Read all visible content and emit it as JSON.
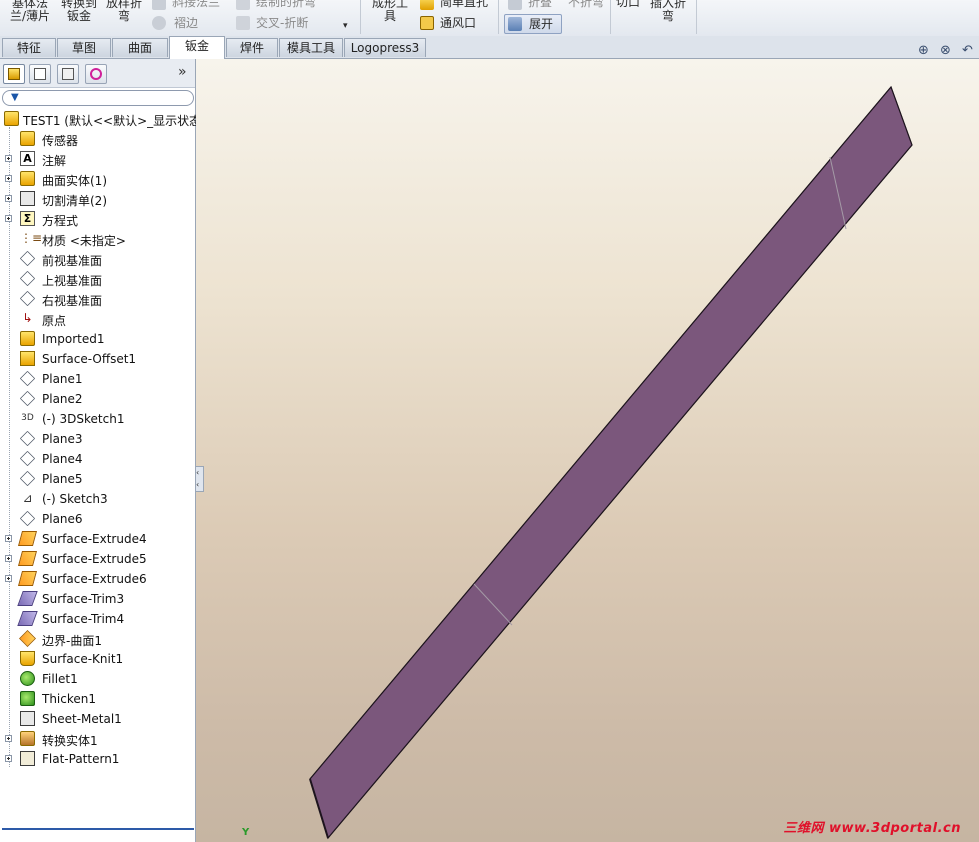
{
  "ribbon": {
    "base_flange": "基体法\n兰/薄片",
    "convert_to_sheet": "转换到\n钣金",
    "lofted_bend": "放样折\n弯",
    "miter_flange": "斜接法兰",
    "hem": "褶边",
    "sketched_bend": "绘制的折弯",
    "cross_break": "交叉-折断",
    "forming_tool": "成形工\n具",
    "simple_hole": "简单直孔",
    "vent": "通风口",
    "fold": "折叠",
    "unfold": "不折弯",
    "flatten": "展开",
    "cut": "切口",
    "insert_bends": "插入折\n弯",
    "more": "▾"
  },
  "tabs": [
    {
      "label": "特征"
    },
    {
      "label": "草图"
    },
    {
      "label": "曲面"
    },
    {
      "label": "钣金"
    },
    {
      "label": "焊件"
    },
    {
      "label": "模具工具"
    },
    {
      "label": "Logopress3"
    }
  ],
  "panel": {
    "expand_chevron": "»",
    "filter_icon": "▼"
  },
  "tree": {
    "root": "TEST1 (默认<<默认>_显示状态",
    "items": [
      {
        "label": "传感器"
      },
      {
        "label": "注解"
      },
      {
        "label": "曲面实体(1)"
      },
      {
        "label": "切割清单(2)"
      },
      {
        "label": "方程式"
      },
      {
        "label": "材质 <未指定>"
      },
      {
        "label": "前视基准面"
      },
      {
        "label": "上视基准面"
      },
      {
        "label": "右视基准面"
      },
      {
        "label": "原点"
      },
      {
        "label": "Imported1"
      },
      {
        "label": "Surface-Offset1"
      },
      {
        "label": "Plane1"
      },
      {
        "label": "Plane2"
      },
      {
        "label": "(-) 3DSketch1"
      },
      {
        "label": "Plane3"
      },
      {
        "label": "Plane4"
      },
      {
        "label": "Plane5"
      },
      {
        "label": "(-) Sketch3"
      },
      {
        "label": "Plane6"
      },
      {
        "label": "Surface-Extrude4"
      },
      {
        "label": "Surface-Extrude5"
      },
      {
        "label": "Surface-Extrude6"
      },
      {
        "label": "Surface-Trim3"
      },
      {
        "label": "Surface-Trim4"
      },
      {
        "label": "边界-曲面1"
      },
      {
        "label": "Surface-Knit1"
      },
      {
        "label": "Fillet1"
      },
      {
        "label": "Thicken1"
      },
      {
        "label": "Sheet-Metal1"
      },
      {
        "label": "转换实体1"
      },
      {
        "label": "Flat-Pattern1"
      }
    ]
  },
  "viewport": {
    "part_color": "#7b577c",
    "watermark": "三维网 www.3dportal.cn",
    "triad_label": "Y"
  }
}
